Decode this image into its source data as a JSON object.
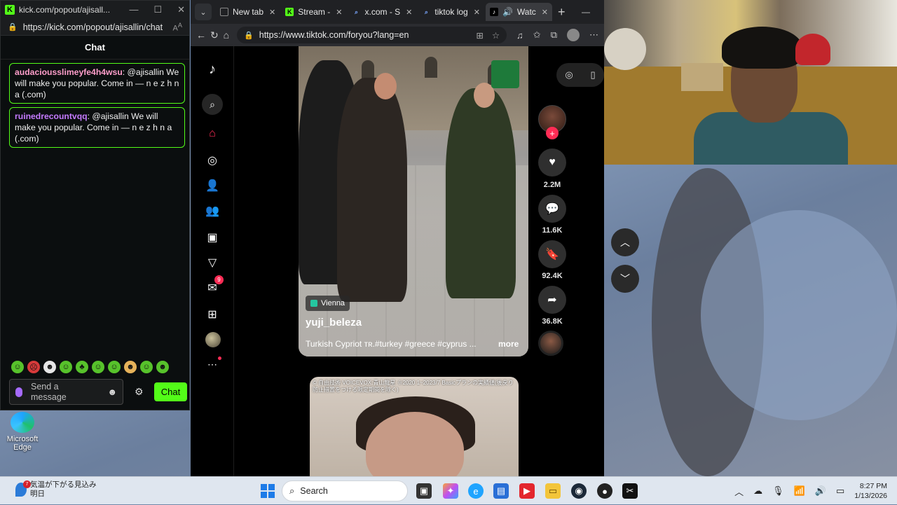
{
  "kick": {
    "window_title": "kick.com/popout/ajisall...",
    "url": "https://kick.com/popout/ajisallin/chat",
    "chat_header": "Chat",
    "messages": [
      {
        "user": "audaciousslimeyfe4h4wsu",
        "text": " @ajisallin We will make you popular. Come in — n e z h n a (.com)"
      },
      {
        "user": "ruinedrecountvqq",
        "text": " @ajisallin We will make you popular. Come in — n e z h n a (.com)"
      }
    ],
    "input_placeholder": "Send a message",
    "send_label": "Chat"
  },
  "desktop": {
    "icon_label": "Microsoft Edge"
  },
  "browser": {
    "tabs": [
      {
        "label": "New tab"
      },
      {
        "label": "Stream -"
      },
      {
        "label": "x.com - S"
      },
      {
        "label": "tiktok log"
      },
      {
        "label": "Watc"
      }
    ],
    "url": "https://www.tiktok.com/foryou?lang=en"
  },
  "tiktok": {
    "sidebar_badge": "9",
    "location": "Vienna",
    "handle": "yuji_beleza",
    "description": "Turkish Cypriot ᴛʀ.#turkey #greece #cyprus ...",
    "more_label": "more",
    "likes": "2.2M",
    "comments": "11.6K",
    "saves": "92.4K",
    "shares": "36.8K",
    "next_caption": "© 自由技術 VOICEVOX:青山龍星 ※2020 1~2023/7 Basicプランの実績値(後戻り防止措置をつける限定期間を除く)"
  },
  "taskbar": {
    "weather_line1": "気温が下がる見込み",
    "weather_line2": "明日",
    "weather_badge": "7",
    "search_label": "Search",
    "time": "8:27 PM",
    "date": "1/13/2026"
  }
}
